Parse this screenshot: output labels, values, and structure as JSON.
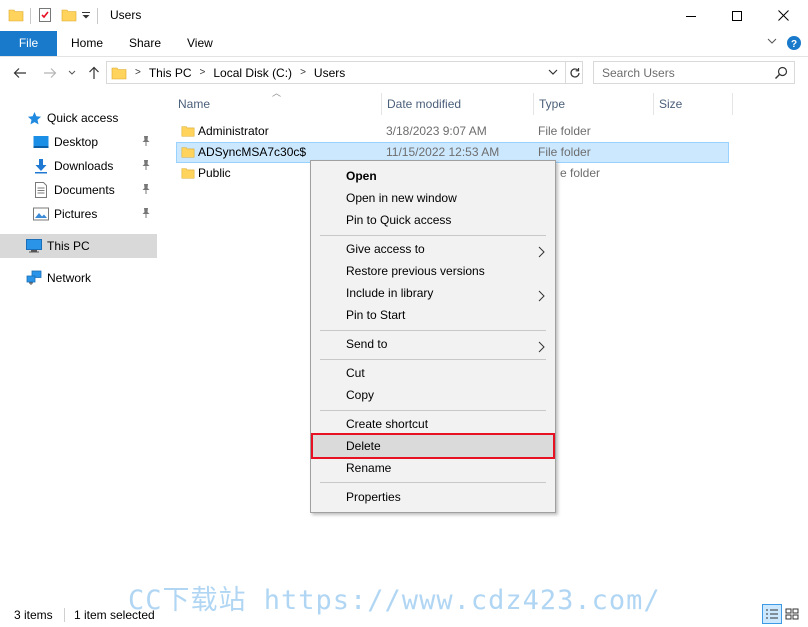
{
  "window": {
    "title": "Users",
    "minimize_glyph": "—",
    "maximize_glyph": "☐",
    "close_glyph": "✕"
  },
  "ribbon": {
    "tabs": [
      "File",
      "Home",
      "Share",
      "View"
    ]
  },
  "address": {
    "crumbs": [
      "This PC",
      "Local Disk (C:)",
      "Users"
    ]
  },
  "search": {
    "placeholder": "Search Users"
  },
  "nav_pane": {
    "items": [
      {
        "label": "Quick access",
        "icon": "star-icon"
      },
      {
        "label": "Desktop",
        "icon": "desktop-icon",
        "pinned": true
      },
      {
        "label": "Downloads",
        "icon": "download-icon",
        "pinned": true
      },
      {
        "label": "Documents",
        "icon": "document-icon",
        "pinned": true
      },
      {
        "label": "Pictures",
        "icon": "pictures-icon",
        "pinned": true
      },
      {
        "label": "This PC",
        "icon": "computer-icon",
        "selected": true
      },
      {
        "label": "Network",
        "icon": "network-icon"
      }
    ]
  },
  "columns": {
    "name": "Name",
    "date": "Date modified",
    "type": "Type",
    "size": "Size"
  },
  "files": [
    {
      "name": "Administrator",
      "date": "3/18/2023 9:07 AM",
      "type": "File folder"
    },
    {
      "name": "ADSyncMSA7c30c$",
      "date": "11/15/2022 12:53 AM",
      "type": "File folder",
      "selected": true
    },
    {
      "name": "Public",
      "date": "",
      "type": "e folder"
    }
  ],
  "context_menu": {
    "open": "Open",
    "open_new_window": "Open in new window",
    "pin_quick_access": "Pin to Quick access",
    "give_access": "Give access to",
    "restore_versions": "Restore previous versions",
    "include_library": "Include in library",
    "pin_start": "Pin to Start",
    "send_to": "Send to",
    "cut": "Cut",
    "copy": "Copy",
    "create_shortcut": "Create shortcut",
    "delete": "Delete",
    "rename": "Rename",
    "properties": "Properties"
  },
  "status": {
    "items": "3 items",
    "selected": "1 item selected"
  },
  "watermark": "CC下载站 https://www.cdz423.com/",
  "colors": {
    "accent": "#1979ca",
    "selection": "#cce8ff",
    "highlight_border": "#e81123",
    "folder": "#ffd35c"
  }
}
